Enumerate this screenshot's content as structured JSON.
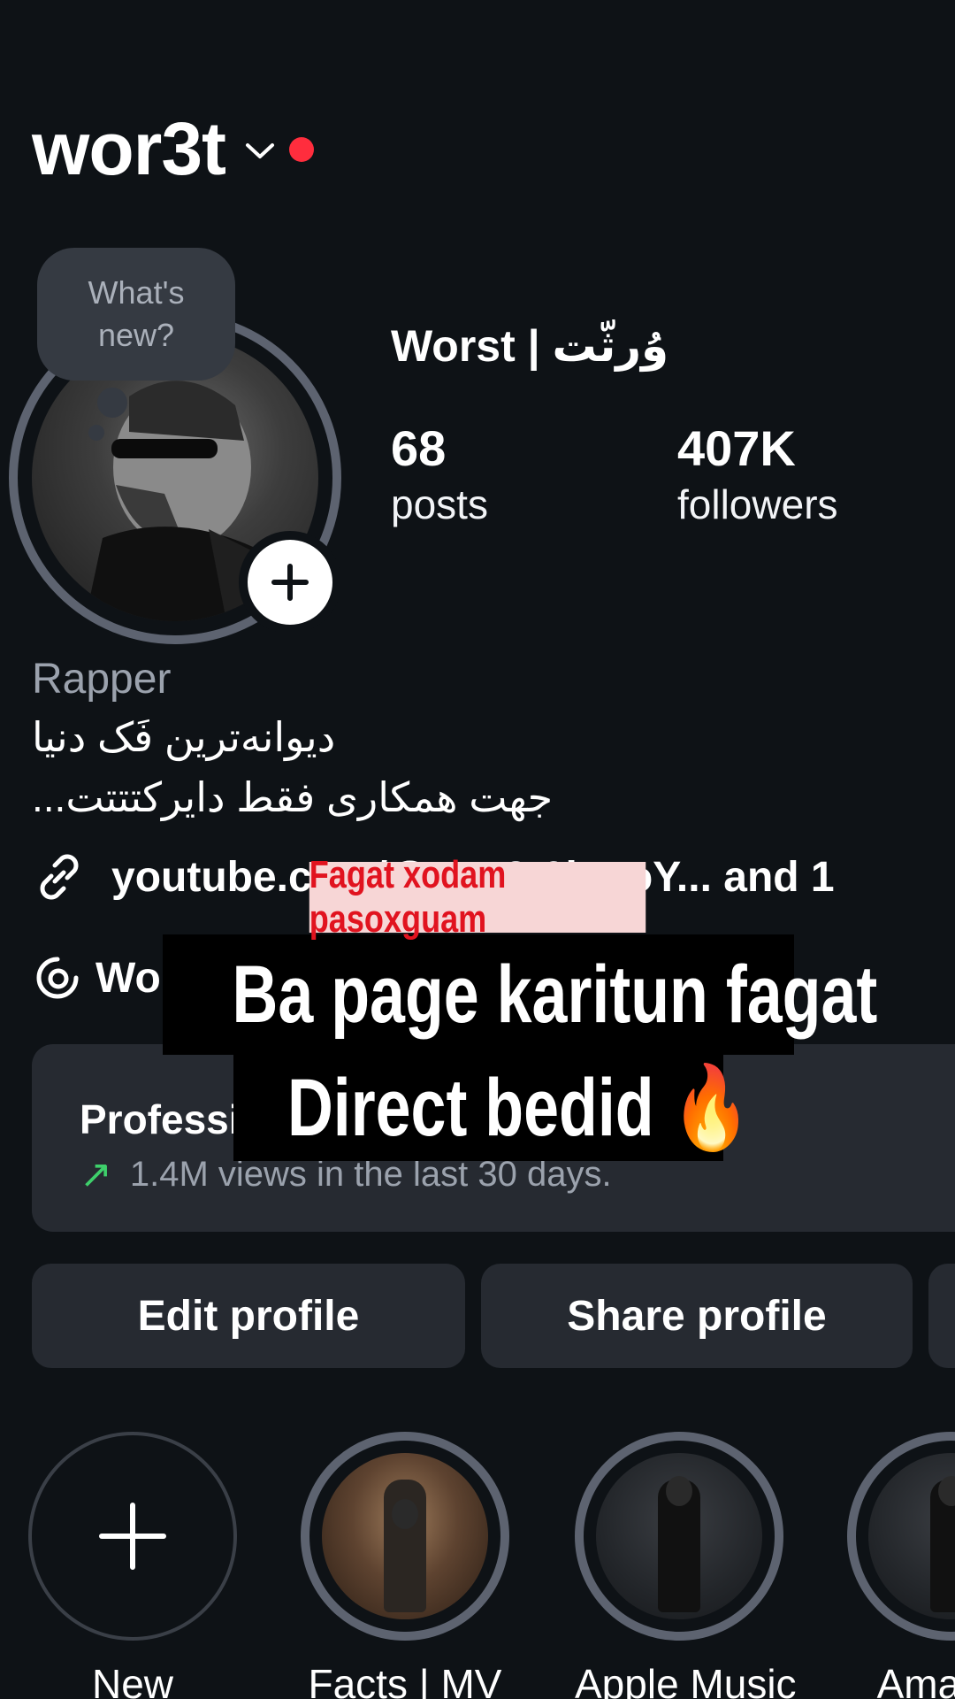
{
  "header": {
    "username": "wor3t"
  },
  "note": {
    "line1": "What's",
    "line2": "new?"
  },
  "profile": {
    "display_name": "Worst | وُرثّت",
    "posts_count": "68",
    "posts_label": "posts",
    "followers_count": "407K",
    "followers_label": "followers",
    "category": "Rapper",
    "bio_line1": "دیوانه‌ترین فَک دنیا",
    "bio_line2": "...جهت همکاری فقط دایرکتتتت",
    "link_text": "youtube.com/@wor3t0iepoY...  and 1",
    "threads_text": "Worst"
  },
  "dashboard": {
    "title": "Professional dashboard",
    "subtitle": "1.4M views in the last 30 days."
  },
  "buttons": {
    "edit": "Edit profile",
    "share": "Share profile"
  },
  "highlights": [
    {
      "label": "New"
    },
    {
      "label": "Facts | MV"
    },
    {
      "label": "Apple Music"
    },
    {
      "label": "Amazon"
    }
  ],
  "overlay": {
    "red_caption": "Fagat xodam pasoxguam",
    "line1": "Ba page karitun fagat",
    "line2": "Direct bedid",
    "emoji": "🔥"
  },
  "colors": {
    "accent_red": "#ff2d3d",
    "background": "#0e1216",
    "card": "#262a31",
    "ring": "#5d6370",
    "trend_green": "#3ecf6b"
  }
}
